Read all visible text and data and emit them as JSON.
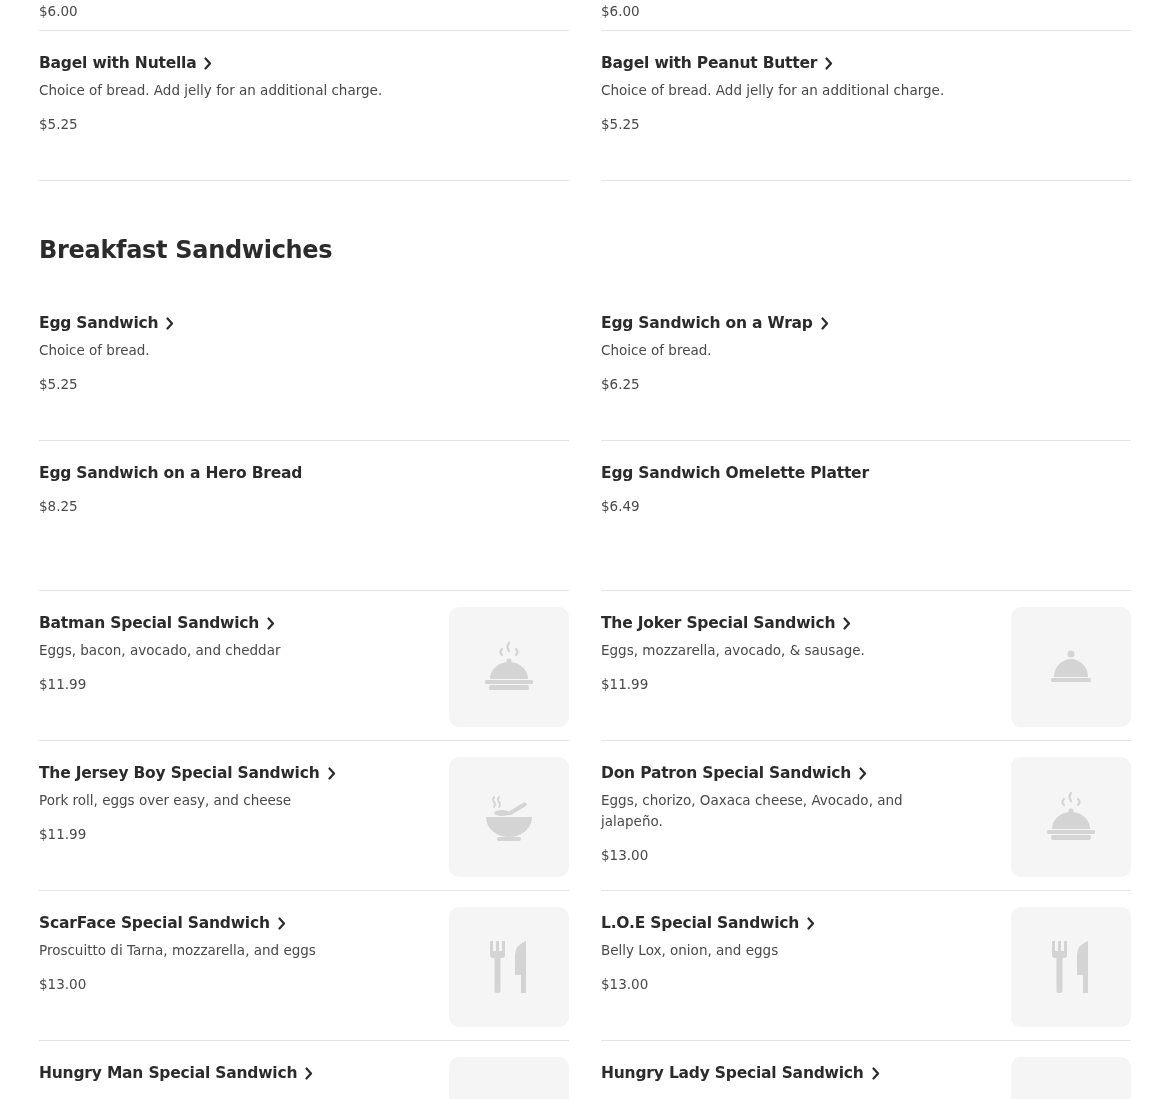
{
  "sections": [
    {
      "items": [
        {
          "kind": "partial",
          "price": "$6.00"
        },
        {
          "kind": "partial",
          "price": "$6.00"
        },
        {
          "kind": "plain",
          "name": "Bagel with Nutella",
          "chevron": true,
          "description": "Choice of bread. Add jelly for an additional charge.",
          "price": "$5.25"
        },
        {
          "kind": "plain",
          "name": "Bagel with Peanut Butter",
          "chevron": true,
          "description": "Choice of bread. Add jelly for an additional charge.",
          "price": "$5.25"
        }
      ]
    },
    {
      "title": "Breakfast Sandwiches",
      "items": [
        {
          "kind": "plain",
          "name": "Egg Sandwich",
          "chevron": true,
          "description": "Choice of bread.",
          "price": "$5.25"
        },
        {
          "kind": "plain",
          "name": "Egg Sandwich on a Wrap",
          "chevron": true,
          "description": "Choice of bread.",
          "price": "$6.25"
        },
        {
          "kind": "plain",
          "name": "Egg Sandwich on a Hero Bread",
          "chevron": false,
          "price": "$8.25"
        },
        {
          "kind": "plain",
          "name": "Egg Sandwich Omelette Platter",
          "chevron": false,
          "price": "$6.49"
        },
        {
          "kind": "steamdish",
          "name": "Batman Special Sandwich",
          "chevron": true,
          "description": "Eggs, bacon, avocado, and cheddar",
          "price": "$11.99"
        },
        {
          "kind": "cloche",
          "name": "The Joker Special Sandwich",
          "chevron": true,
          "description": "Eggs, mozzarella, avocado, & sausage.",
          "price": "$11.99"
        },
        {
          "kind": "bowl",
          "name": "The Jersey Boy Special Sandwich",
          "chevron": true,
          "description": "Pork roll, eggs over easy, and cheese",
          "price": "$11.99"
        },
        {
          "kind": "steamdish",
          "name": "Don Patron Special Sandwich",
          "chevron": true,
          "description": "Eggs, chorizo, Oaxaca cheese, Avocado, and jalapeño.",
          "price": "$13.00"
        },
        {
          "kind": "utensils",
          "name": "ScarFace Special Sandwich",
          "chevron": true,
          "description": "Proscuitto di Tarna, mozzarella, and eggs",
          "price": "$13.00"
        },
        {
          "kind": "utensils",
          "name": "L.O.E Special Sandwich",
          "chevron": true,
          "description": "Belly Lox, onion, and eggs",
          "price": "$13.00"
        },
        {
          "kind": "blank",
          "name": "Hungry Man Special Sandwich",
          "chevron": true
        },
        {
          "kind": "blank",
          "name": "Hungry Lady Special Sandwich",
          "chevron": true
        }
      ]
    }
  ]
}
